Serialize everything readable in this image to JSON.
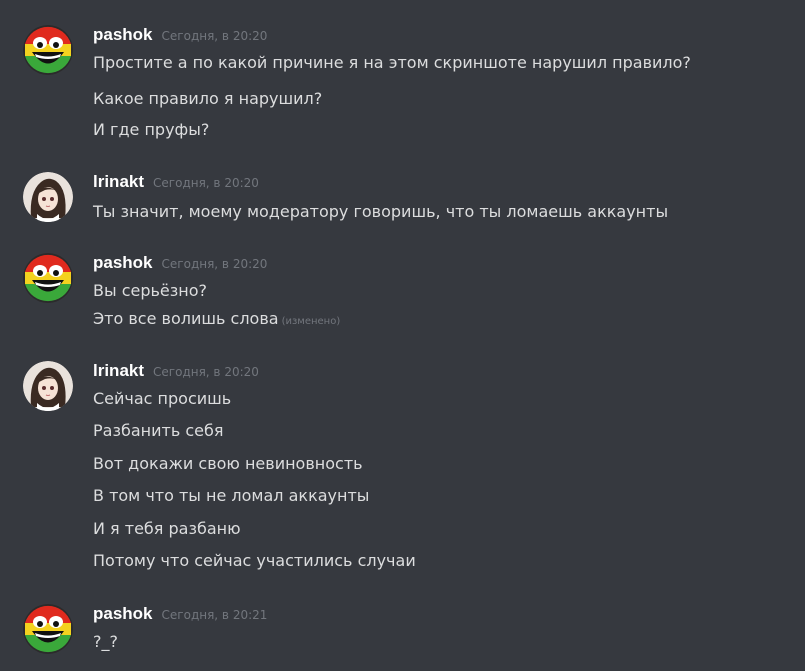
{
  "colors": {
    "background": "#36393f",
    "username": "#ffffff",
    "timestamp": "#72767d",
    "message_text": "#dcddde"
  },
  "messages": [
    {
      "author": "pashok",
      "avatar_icon": "awesome-face-icon",
      "timestamp": "Сегодня, в 20:20",
      "lines": [
        "Простите а по какой причине я на этом скриншоте нарушил правило?",
        "Какое правило я нарушил?",
        "И где пруфы?"
      ]
    },
    {
      "author": "lrinakt",
      "avatar_icon": "anime-girl-avatar-icon",
      "timestamp": "Сегодня, в 20:20",
      "lines": [
        "Ты значит, моему модератору говоришь, что ты ломаешь аккаунты"
      ]
    },
    {
      "author": "pashok",
      "avatar_icon": "awesome-face-icon",
      "timestamp": "Сегодня, в 20:20",
      "lines": [
        "Вы серьёзно?",
        "Это все волишь слова"
      ],
      "edited_label": "(изменено)"
    },
    {
      "author": "lrinakt",
      "avatar_icon": "anime-girl-avatar-icon",
      "timestamp": "Сегодня, в 20:20",
      "lines": [
        "Сейчас просишь",
        "Разбанить себя",
        "Вот докажи свою невиновность",
        "В том что ты не ломал аккаунты",
        "И я тебя разбаню",
        "Потому что сейчас участились случаи"
      ]
    },
    {
      "author": "pashok",
      "avatar_icon": "awesome-face-icon",
      "timestamp": "Сегодня, в 20:21",
      "lines": [
        "?_?"
      ]
    }
  ]
}
